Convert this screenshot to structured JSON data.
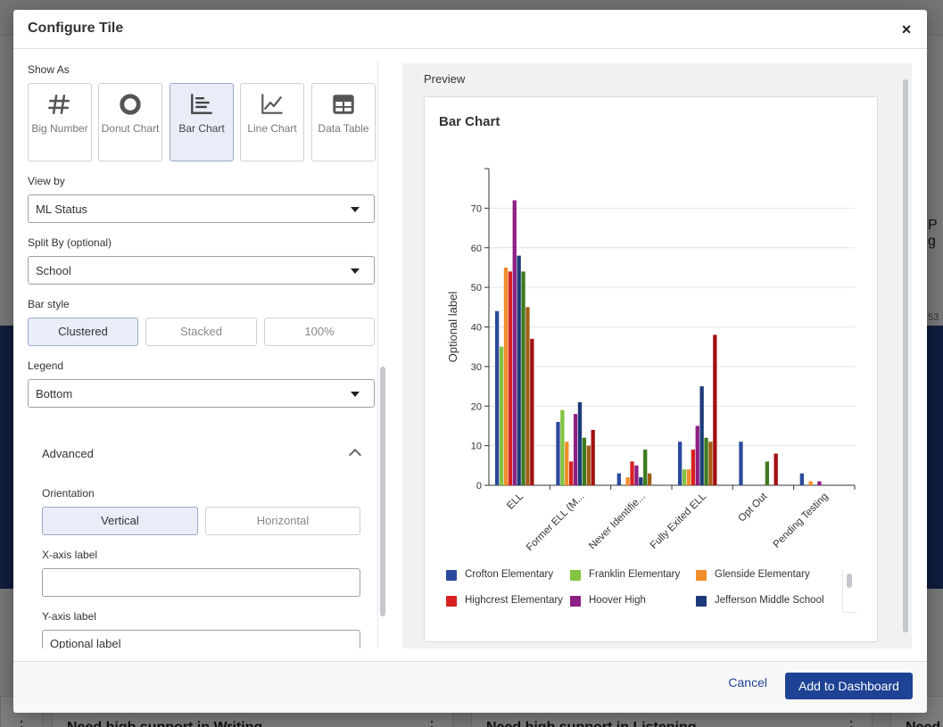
{
  "background": {
    "right_text_top": "P g",
    "right_text_mid": "53",
    "cards": [
      {
        "title": "Need high support in Writing"
      },
      {
        "title": "Need high support in Listening"
      },
      {
        "title": "Need"
      }
    ]
  },
  "modal": {
    "title": "Configure Tile",
    "close_icon": "×"
  },
  "settings": {
    "show_as_label": "Show As",
    "tiles": [
      {
        "label": "Big Number",
        "icon": "hash-icon",
        "selected": false
      },
      {
        "label": "Donut Chart",
        "icon": "donut-icon",
        "selected": false
      },
      {
        "label": "Bar Chart",
        "icon": "bar-chart-icon",
        "selected": true
      },
      {
        "label": "Line Chart",
        "icon": "line-chart-icon",
        "selected": false
      },
      {
        "label": "Data Table",
        "icon": "table-icon",
        "selected": false
      }
    ],
    "view_by_label": "View by",
    "view_by_value": "ML Status",
    "split_by_label": "Split By (optional)",
    "split_by_value": "School",
    "bar_style_label": "Bar style",
    "bar_style_options": [
      "Clustered",
      "Stacked",
      "100%"
    ],
    "bar_style_selected": "Clustered",
    "legend_label": "Legend",
    "legend_value": "Bottom",
    "advanced_label": "Advanced",
    "orientation_label": "Orientation",
    "orientation_options": [
      "Vertical",
      "Horizontal"
    ],
    "orientation_selected": "Vertical",
    "x_axis_label": "X-axis label",
    "x_axis_value": "",
    "y_axis_label": "Y-axis label",
    "y_axis_value": "Optional label"
  },
  "preview": {
    "label": "Preview"
  },
  "chart_data": {
    "type": "bar",
    "title": "Bar Chart",
    "xlabel": "",
    "ylabel": "Optional label",
    "ylim": [
      0,
      80
    ],
    "yticks": [
      0,
      10,
      20,
      30,
      40,
      50,
      60,
      70
    ],
    "grid": true,
    "legend_position": "bottom",
    "categories": [
      "ELL",
      "Former ELL (M...",
      "Never Identifie...",
      "Fully Exited ELL",
      "Opt Out",
      "Pending Testing"
    ],
    "series": [
      {
        "name": "Crofton Elementary",
        "color": "#2a4a9c",
        "values": [
          44,
          16,
          3,
          11,
          11,
          3
        ]
      },
      {
        "name": "Franklin Elementary",
        "color": "#82c341",
        "values": [
          35,
          19,
          0,
          4,
          0,
          0
        ]
      },
      {
        "name": "Glenside Elementary",
        "color": "#f28e2b",
        "values": [
          55,
          11,
          2,
          4,
          0,
          1
        ]
      },
      {
        "name": "Highcrest Elementary",
        "color": "#d62020",
        "values": [
          54,
          6,
          6,
          9,
          0,
          0
        ]
      },
      {
        "name": "Hoover High",
        "color": "#8e1f83",
        "values": [
          72,
          18,
          5,
          15,
          0,
          1
        ]
      },
      {
        "name": "Jefferson Middle School",
        "color": "#1c3a7a",
        "values": [
          58,
          21,
          2,
          25,
          0,
          0
        ]
      },
      {
        "name": "",
        "color": "#3d7a1e",
        "values": [
          54,
          12,
          9,
          12,
          6,
          0
        ]
      },
      {
        "name": "",
        "color": "#a35c14",
        "values": [
          45,
          10,
          3,
          11,
          0,
          0
        ]
      },
      {
        "name": "",
        "color": "#a30f0f",
        "values": [
          37,
          14,
          0,
          38,
          8,
          0
        ]
      }
    ]
  },
  "footer": {
    "cancel": "Cancel",
    "add": "Add to Dashboard"
  }
}
